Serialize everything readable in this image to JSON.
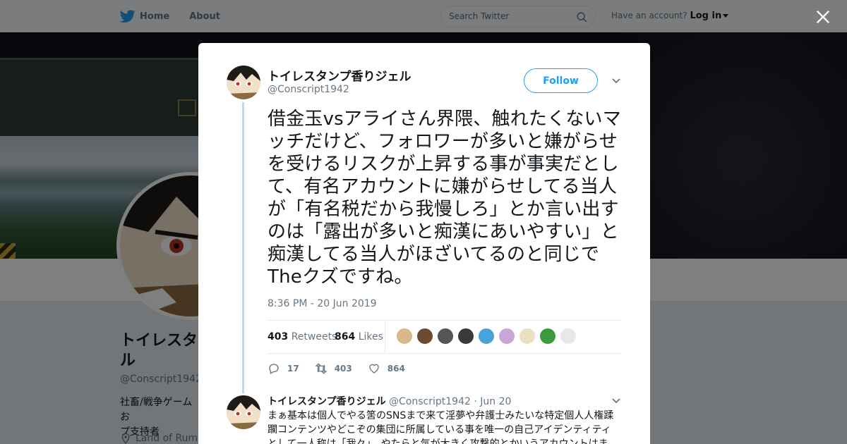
{
  "nav": {
    "home_label": "Home",
    "about_label": "About",
    "search_placeholder": "Search Twitter",
    "account_prompt": "Have an account?",
    "login_label": "Log in"
  },
  "profile": {
    "name": "トイレスタンプ香りジェル",
    "name_visible": "トイレスタ\nル",
    "handle": "@Conscript1942",
    "bio_visible": "社畜/戦争ゲームお\nプ支持者",
    "location": "Land of Rum"
  },
  "tweet": {
    "author_name": "トイレスタンプ香りジェル",
    "author_handle": "@Conscript1942",
    "follow_label": "Follow",
    "text": "借金玉vsアライさん界隈、触れたくないマッチだけど、フォロワーが多いと嫌がらせを受けるリスクが上昇する事が事実だとして、有名アカウントに嫌がらせしてる当人が「有名税だから我慢しろ」とか言い出すのは「露出が多いと痴漢にあいやすい」と痴漢してる当人がほざいてるのと同じでTheクズですね。",
    "timestamp": "8:36 PM - 20 Jun 2019",
    "retweets_count": "403",
    "retweets_label": "Retweets",
    "likes_count": "864",
    "likes_label": "Likes",
    "reply_count": "17",
    "retweet_action_count": "403",
    "like_action_count": "864"
  },
  "liker_colors": [
    "#d9b98c",
    "#6b4a32",
    "#555555",
    "#3a3a3a",
    "#4aa3d8",
    "#c9a6d8",
    "#e8e0c0",
    "#3c9a3c",
    "#e8e8e8"
  ],
  "reply": {
    "author_name": "トイレスタンプ香りジェル",
    "author_handle": "@Conscript1942",
    "separator": "·",
    "date": "Jun 20",
    "text": "まぁ基本は個人でやる筈のSNSまで来て淫夢や弁護士みたいな特定個人人権蹂躙コンテンツやどこぞの集団に所属している事を唯一の自己アイデンティティとして一人称は「我々」、やたらと気が大きく攻撃的とかいうアカウントはま"
  }
}
